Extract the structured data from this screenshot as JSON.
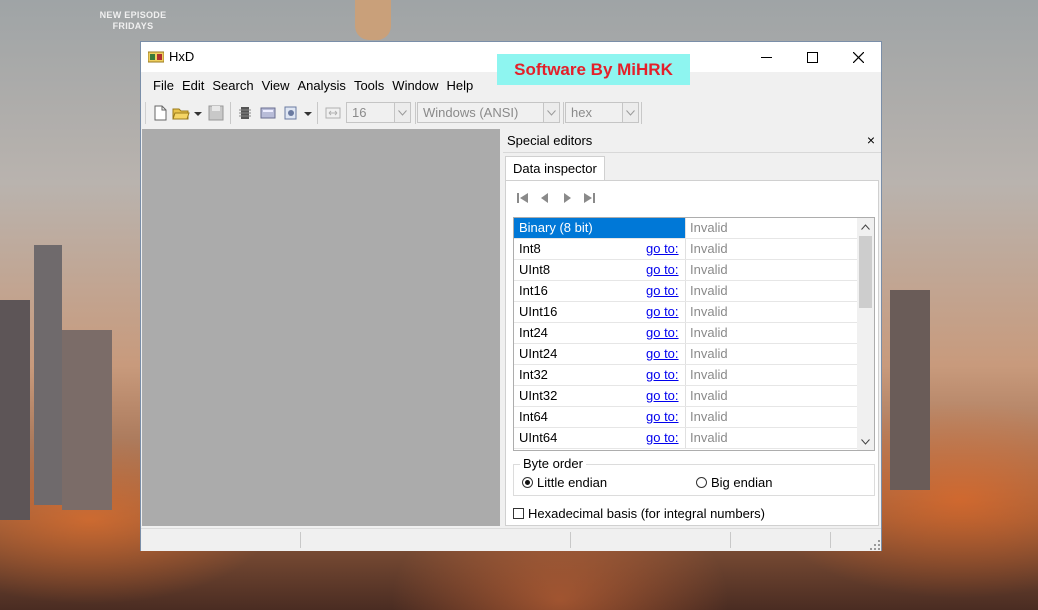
{
  "desktop": {
    "promo_line1": "NEW EPISODE",
    "promo_line2": "FRIDAYS"
  },
  "window": {
    "title": "HxD",
    "watermark": "Software By MiHRK",
    "menu": [
      "File",
      "Edit",
      "Search",
      "View",
      "Analysis",
      "Tools",
      "Window",
      "Help"
    ],
    "toolbar": {
      "bytes_per_row": "16",
      "charset": "Windows (ANSI)",
      "offset_base": "hex"
    }
  },
  "special_editors": {
    "title": "Special editors",
    "close_glyph": "×",
    "tab": "Data inspector",
    "rows": [
      {
        "name": "Binary (8 bit)",
        "goto": "",
        "value": "Invalid",
        "selected": true
      },
      {
        "name": "Int8",
        "goto": "go to:",
        "value": "Invalid"
      },
      {
        "name": "UInt8",
        "goto": "go to:",
        "value": "Invalid"
      },
      {
        "name": "Int16",
        "goto": "go to:",
        "value": "Invalid"
      },
      {
        "name": "UInt16",
        "goto": "go to:",
        "value": "Invalid"
      },
      {
        "name": "Int24",
        "goto": "go to:",
        "value": "Invalid"
      },
      {
        "name": "UInt24",
        "goto": "go to:",
        "value": "Invalid"
      },
      {
        "name": "Int32",
        "goto": "go to:",
        "value": "Invalid"
      },
      {
        "name": "UInt32",
        "goto": "go to:",
        "value": "Invalid"
      },
      {
        "name": "Int64",
        "goto": "go to:",
        "value": "Invalid"
      },
      {
        "name": "UInt64",
        "goto": "go to:",
        "value": "Invalid"
      }
    ],
    "byte_order": {
      "label": "Byte order",
      "little": "Little endian",
      "big": "Big endian",
      "selected": "little"
    },
    "hex_basis": {
      "label": "Hexadecimal basis (for integral numbers)",
      "checked": false
    }
  }
}
